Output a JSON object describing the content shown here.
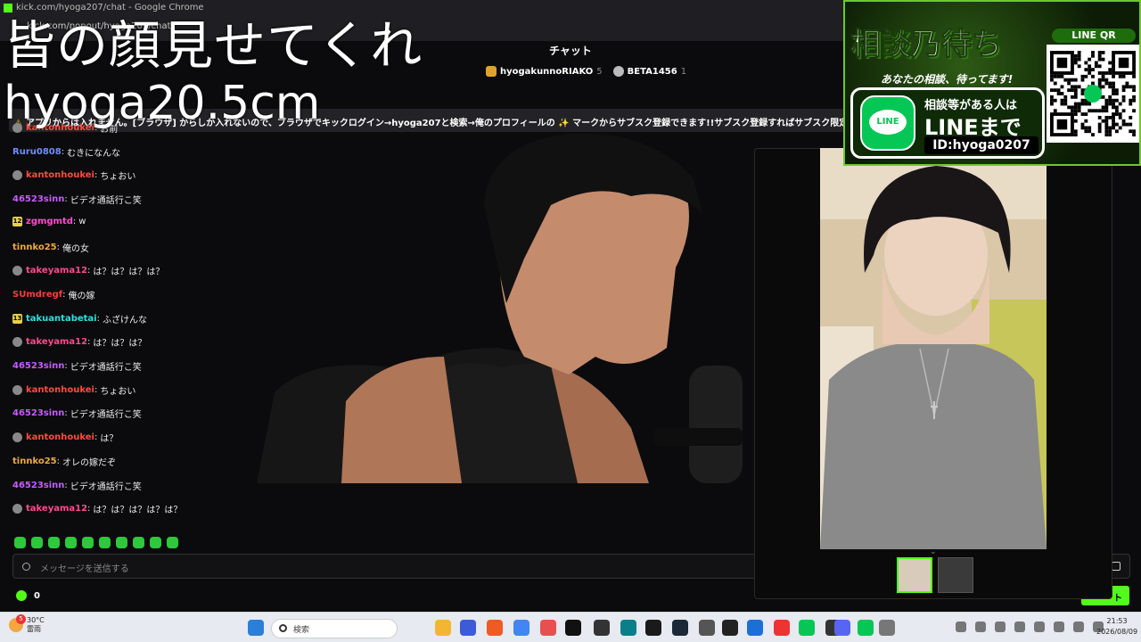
{
  "browser": {
    "tab_title": "kick.com/hyoga207/chat - Google Chrome",
    "url": "kick.com/popout/hyoga207/chat"
  },
  "overlay": {
    "title": "皆の顔見せてくれ",
    "subtitle": "hyoga20.5cm"
  },
  "chat": {
    "header": "チャット",
    "gifters": [
      {
        "name": "hyogakunnoRIAKO",
        "count": "5"
      },
      {
        "name": "BETA1456",
        "count": "1"
      }
    ],
    "pinned": "アプリからは入れません。[ブラウザ] からしか入れないので、ブラウザでキックログイン→hyoga207と検索→俺のプロフィールの ✨ マークからサブスク登録できます!!サブスク登録すればサブスク限定",
    "messages": [
      {
        "badge": "mod",
        "badge_text": "",
        "user": "kantonhoukei",
        "color": "#ff4a3d",
        "text": "お前"
      },
      {
        "badge": "",
        "badge_text": "",
        "user": "Ruru0808",
        "color": "#6f8dff",
        "text": "むきになんな"
      },
      {
        "badge": "mod",
        "badge_text": "",
        "user": "kantonhoukei",
        "color": "#ff4a3d",
        "text": "ちょおい"
      },
      {
        "badge": "",
        "badge_text": "",
        "user": "46523sinn",
        "color": "#c65bff",
        "text": "ビデオ通話行こ笑"
      },
      {
        "badge": "sub",
        "badge_text": "12",
        "user": "zgmgmtd",
        "color": "#ff4ad6",
        "text": "w"
      },
      {
        "badge": "",
        "badge_text": "",
        "user": "tinnko25",
        "color": "#f0a93a",
        "text": "俺の女"
      },
      {
        "badge": "mod",
        "badge_text": "",
        "user": "takeyama12",
        "color": "#ff4a8a",
        "text": "は？は？は？は？"
      },
      {
        "badge": "",
        "badge_text": "",
        "user": "SUmdregf",
        "color": "#ff3b3b",
        "text": "俺の嫁"
      },
      {
        "badge": "sub",
        "badge_text": "13",
        "user": "takuantabetai",
        "color": "#2fe0e0",
        "text": "ふざけんな"
      },
      {
        "badge": "mod",
        "badge_text": "",
        "user": "takeyama12",
        "color": "#ff4a8a",
        "text": "は？は？は？"
      },
      {
        "badge": "",
        "badge_text": "",
        "user": "46523sinn",
        "color": "#c65bff",
        "text": "ビデオ通話行こ笑"
      },
      {
        "badge": "mod",
        "badge_text": "",
        "user": "kantonhoukei",
        "color": "#ff4a3d",
        "text": "ちょおい"
      },
      {
        "badge": "",
        "badge_text": "",
        "user": "46523sinn",
        "color": "#c65bff",
        "text": "ビデオ通話行こ笑"
      },
      {
        "badge": "mod",
        "badge_text": "",
        "user": "kantonhoukei",
        "color": "#ff4a3d",
        "text": "は？"
      },
      {
        "badge": "",
        "badge_text": "",
        "user": "tinnko25",
        "color": "#f0a93a",
        "text": "オレの嫁だぞ"
      },
      {
        "badge": "",
        "badge_text": "",
        "user": "46523sinn",
        "color": "#c65bff",
        "text": "ビデオ通話行こ笑"
      },
      {
        "badge": "mod",
        "badge_text": "",
        "user": "takeyama12",
        "color": "#ff4a8a",
        "text": "は？は？は？は？は？"
      }
    ],
    "input_placeholder": "メッセージを送信する",
    "points": "0",
    "send_label": "ト"
  },
  "ad": {
    "headline": "相談乃待ち",
    "tagline": "あなたの相談、待ってます!",
    "line1": "相談等がある人は",
    "line2": "LINEまで",
    "line_id": "ID:hyoga0207",
    "qr_label": "LINE QR",
    "logo_text": "LINE"
  },
  "taskbar": {
    "weather_temp": "30°C",
    "weather_desc": "雷雨",
    "weather_badge": "5",
    "search_placeholder": "検索",
    "time": "21:53",
    "date": "2026/08/09"
  },
  "colors": {
    "kick_green": "#53fc18",
    "line_green": "#06c755"
  }
}
